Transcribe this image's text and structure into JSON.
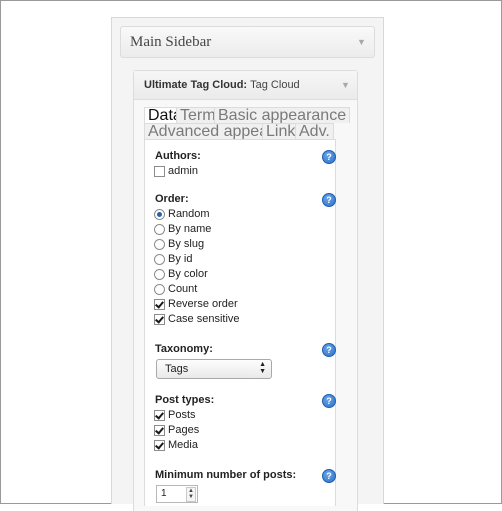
{
  "sidebar": {
    "title": "Main Sidebar"
  },
  "widget": {
    "title_plugin": "Ultimate Tag Cloud:",
    "title_name": "Tag Cloud"
  },
  "tabs": [
    "Data",
    "Terms",
    "Basic appearance",
    "Advanced appearance",
    "Links",
    "Adv."
  ],
  "active_tab": "Data",
  "authors": {
    "label": "Authors:",
    "options": [
      {
        "label": "admin",
        "checked": false
      }
    ]
  },
  "order": {
    "label": "Order:",
    "radios": [
      {
        "label": "Random",
        "selected": true
      },
      {
        "label": "By name",
        "selected": false
      },
      {
        "label": "By slug",
        "selected": false
      },
      {
        "label": "By id",
        "selected": false
      },
      {
        "label": "By color",
        "selected": false
      },
      {
        "label": "Count",
        "selected": false
      }
    ],
    "checks": [
      {
        "label": "Reverse order",
        "checked": true
      },
      {
        "label": "Case sensitive",
        "checked": true
      }
    ]
  },
  "taxonomy": {
    "label": "Taxonomy:",
    "value": "Tags"
  },
  "post_types": {
    "label": "Post types:",
    "options": [
      {
        "label": "Posts",
        "checked": true
      },
      {
        "label": "Pages",
        "checked": true
      },
      {
        "label": "Media",
        "checked": true
      }
    ]
  },
  "min_posts": {
    "label": "Minimum number of posts:",
    "value": "1"
  },
  "help_icon_text": "?",
  "colors": {
    "help_blue": "#2c6fc6",
    "text": "#222222"
  }
}
